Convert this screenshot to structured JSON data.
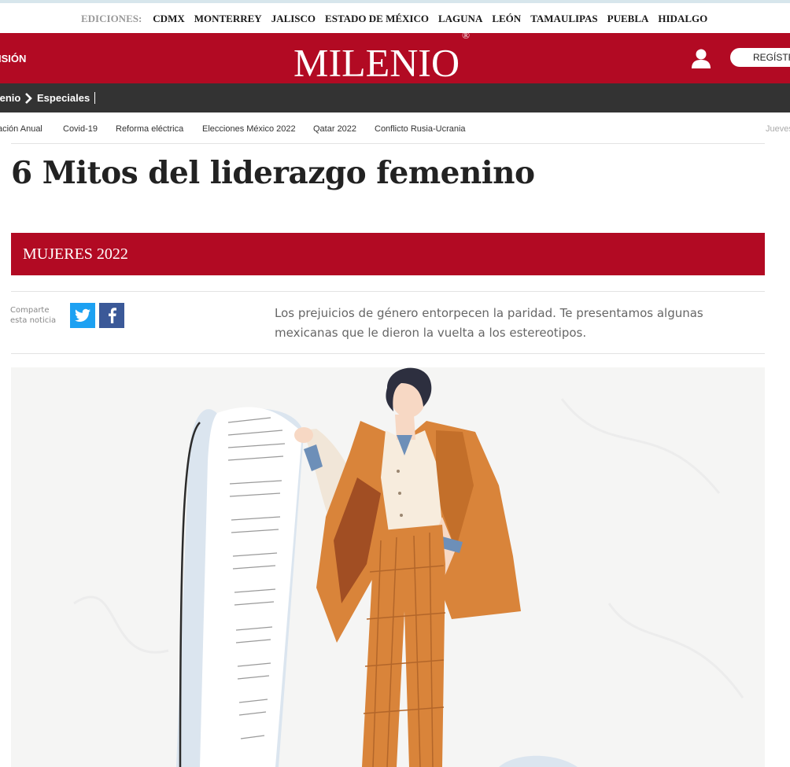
{
  "editions": {
    "label": "EDICIONES:",
    "items": [
      "CDMX",
      "MONTERREY",
      "JALISCO",
      "ESTADO DE MÉXICO",
      "LAGUNA",
      "LEÓN",
      "TAMAULIPAS",
      "PUEBLA",
      "HIDALGO"
    ]
  },
  "header": {
    "tv_label": "ISIÓN",
    "logo": "MILENIO",
    "logo_mark": "®",
    "user_icon": "user-icon",
    "register_label": "REGÍSTR"
  },
  "breadcrumb": {
    "home": "lenio",
    "chevron_icon": "chevron-right-icon",
    "current": "Especiales"
  },
  "topics": [
    "ación Anual",
    "Covid-19",
    "Reforma eléctrica",
    "Elecciones México 2022",
    "Qatar 2022",
    "Conflicto Rusia-Ucrania"
  ],
  "date_stub": "Jueves",
  "article": {
    "title": "6 Mitos del liderazgo femenino",
    "section": "MUJERES 2022",
    "share_line1": "Comparte",
    "share_line2": "esta noticia",
    "share_icons": [
      "twitter-icon",
      "facebook-icon"
    ],
    "summary": "Los prejuicios de género entorpecen la paridad. Te presentamos algunas mexicanas que le dieron la vuelta a los estereotipos."
  },
  "colors": {
    "brand": "#b20a23",
    "breadcrumb_bg": "#333333",
    "twitter": "#1da1f2",
    "facebook": "#3b5998",
    "jacket": "#d9843a"
  }
}
